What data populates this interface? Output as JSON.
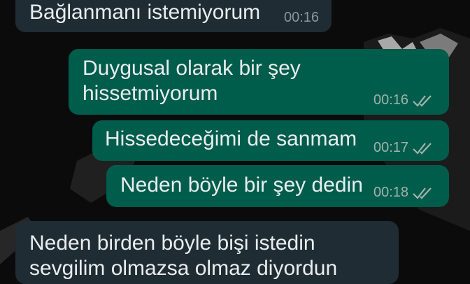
{
  "chat": {
    "messages": [
      {
        "direction": "incoming",
        "text_lines": [
          "Bağlanmanı istemiyorum"
        ],
        "time": "00:16"
      },
      {
        "direction": "outgoing",
        "text_lines": [
          "Duygusal olarak bir şey",
          "hissetmiyorum"
        ],
        "time": "00:16",
        "status_icon": "double-check-icon"
      },
      {
        "direction": "outgoing",
        "text_lines": [
          "Hissedeceğimi de sanmam"
        ],
        "time": "00:17",
        "status_icon": "double-check-icon"
      },
      {
        "direction": "outgoing",
        "text_lines": [
          "Neden böyle bir şey dedin"
        ],
        "time": "00:18",
        "status_icon": "double-check-icon"
      },
      {
        "direction": "incoming",
        "text_lines": [
          "Neden birden böyle bişi istedin",
          "sevgilim olmazsa olmaz diyordun"
        ]
      }
    ]
  },
  "colors": {
    "background": "#0b0b0b",
    "incoming_bubble": "#1f2c33",
    "outgoing_bubble": "#005c4b",
    "text": "#e9edef",
    "meta_text": "#8696a0"
  }
}
